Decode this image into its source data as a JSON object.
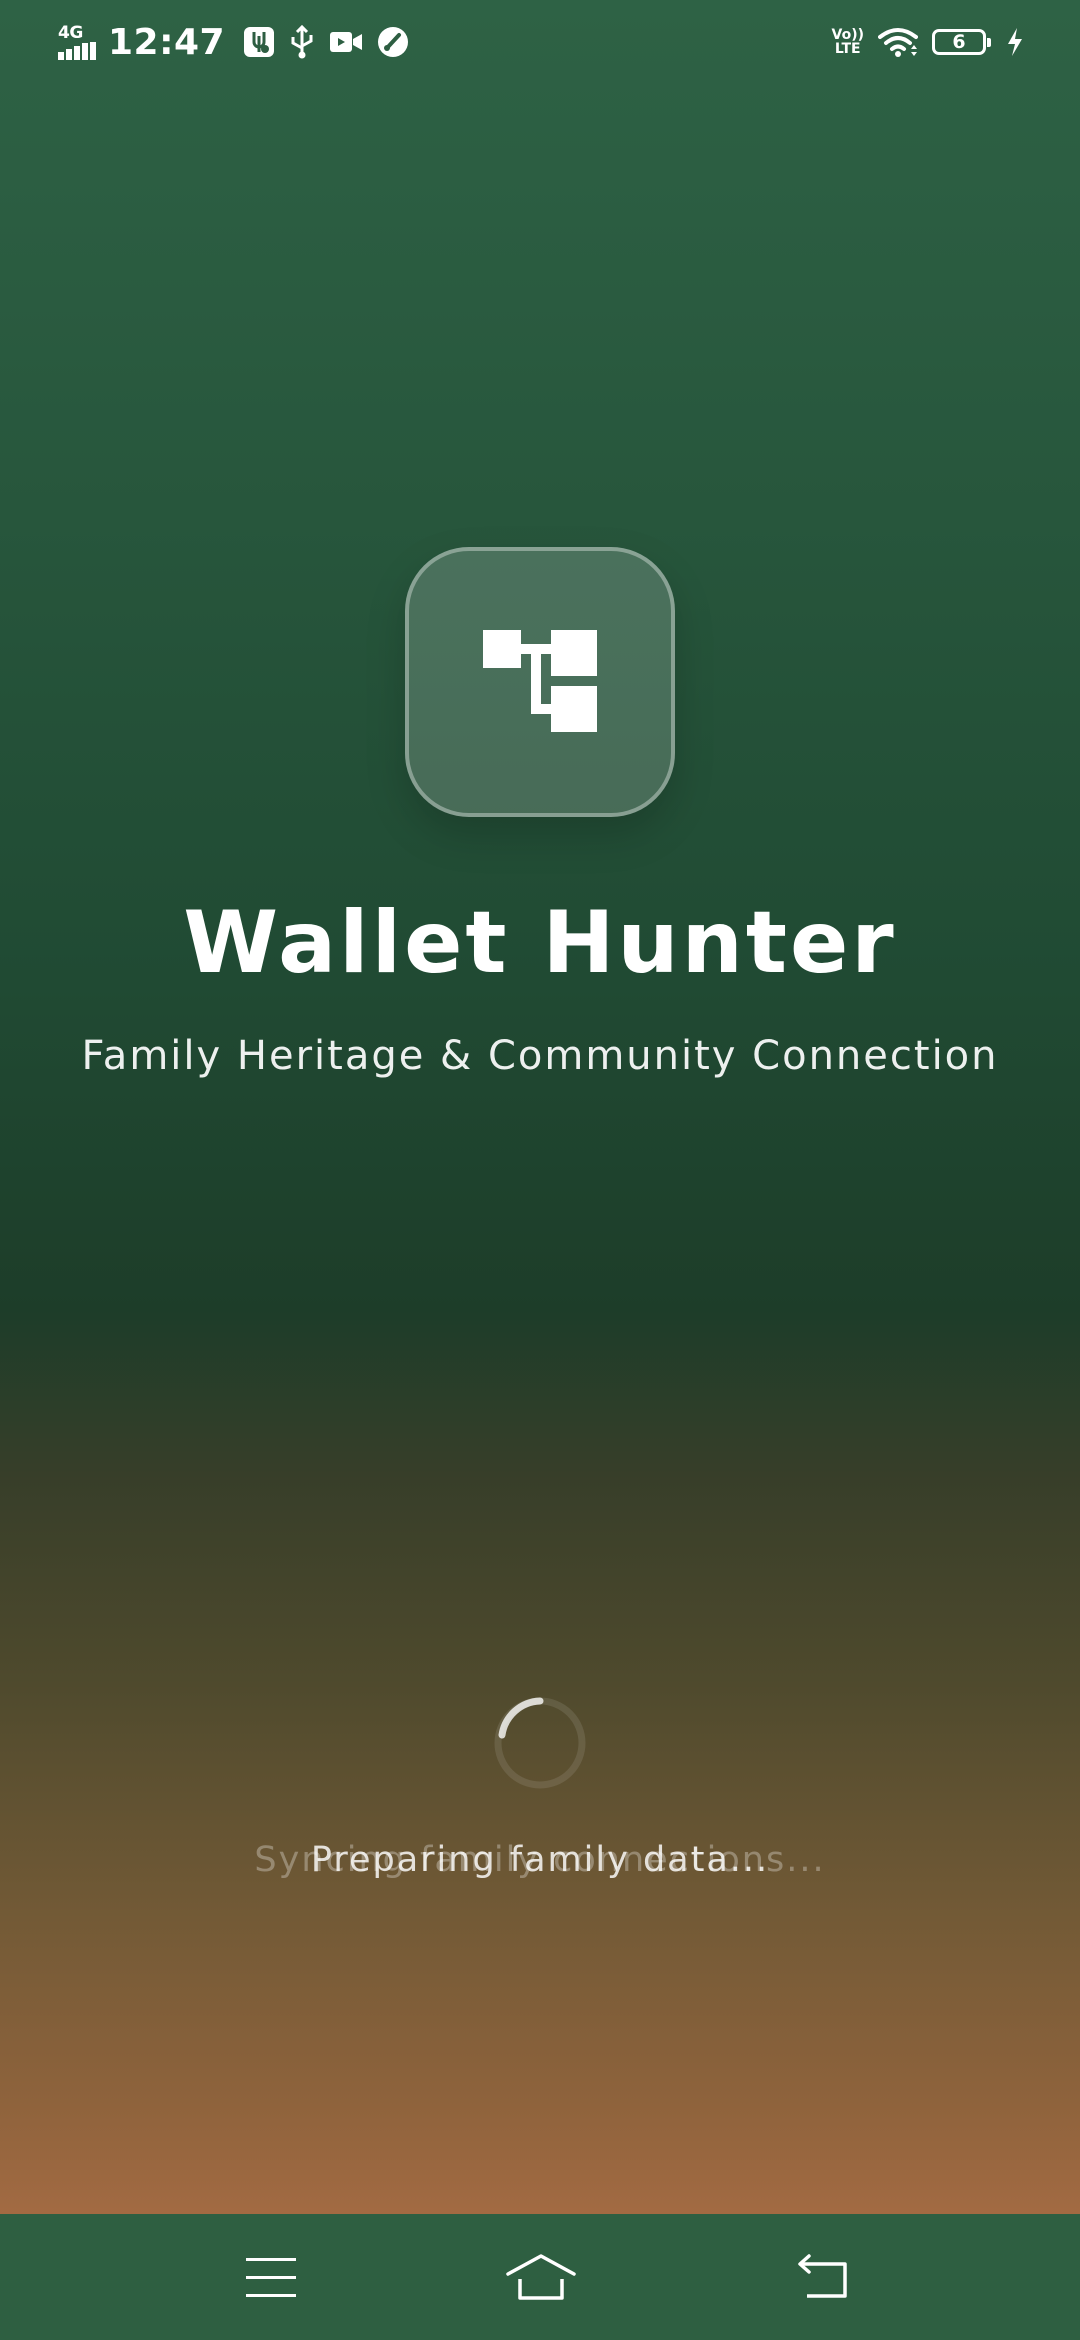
{
  "status_bar": {
    "network_type": "4G",
    "time": "12:47",
    "volte_top": "Vo))",
    "volte_bottom": "LTE",
    "battery_level": "6",
    "icons": [
      "signal-icon",
      "usb-debug-icon",
      "usb-icon",
      "video-record-icon",
      "speedometer-icon",
      "volte-icon",
      "wifi-icon",
      "battery-icon",
      "charging-icon"
    ]
  },
  "app": {
    "logo_icon": "family-tree-icon",
    "title": "Wallet Hunter",
    "subtitle": "Family Heritage & Community Connection"
  },
  "loading": {
    "message_previous": "Syncing family connections...",
    "message_current": "Preparing family data..."
  },
  "nav_bar": {
    "items": [
      "menu-icon",
      "home-icon",
      "back-icon"
    ]
  },
  "colors": {
    "top_green": "#2e6245",
    "dark_green": "#1d3d29",
    "bottom_brown": "#a86c44",
    "nav_bar": "#2e5f41"
  }
}
